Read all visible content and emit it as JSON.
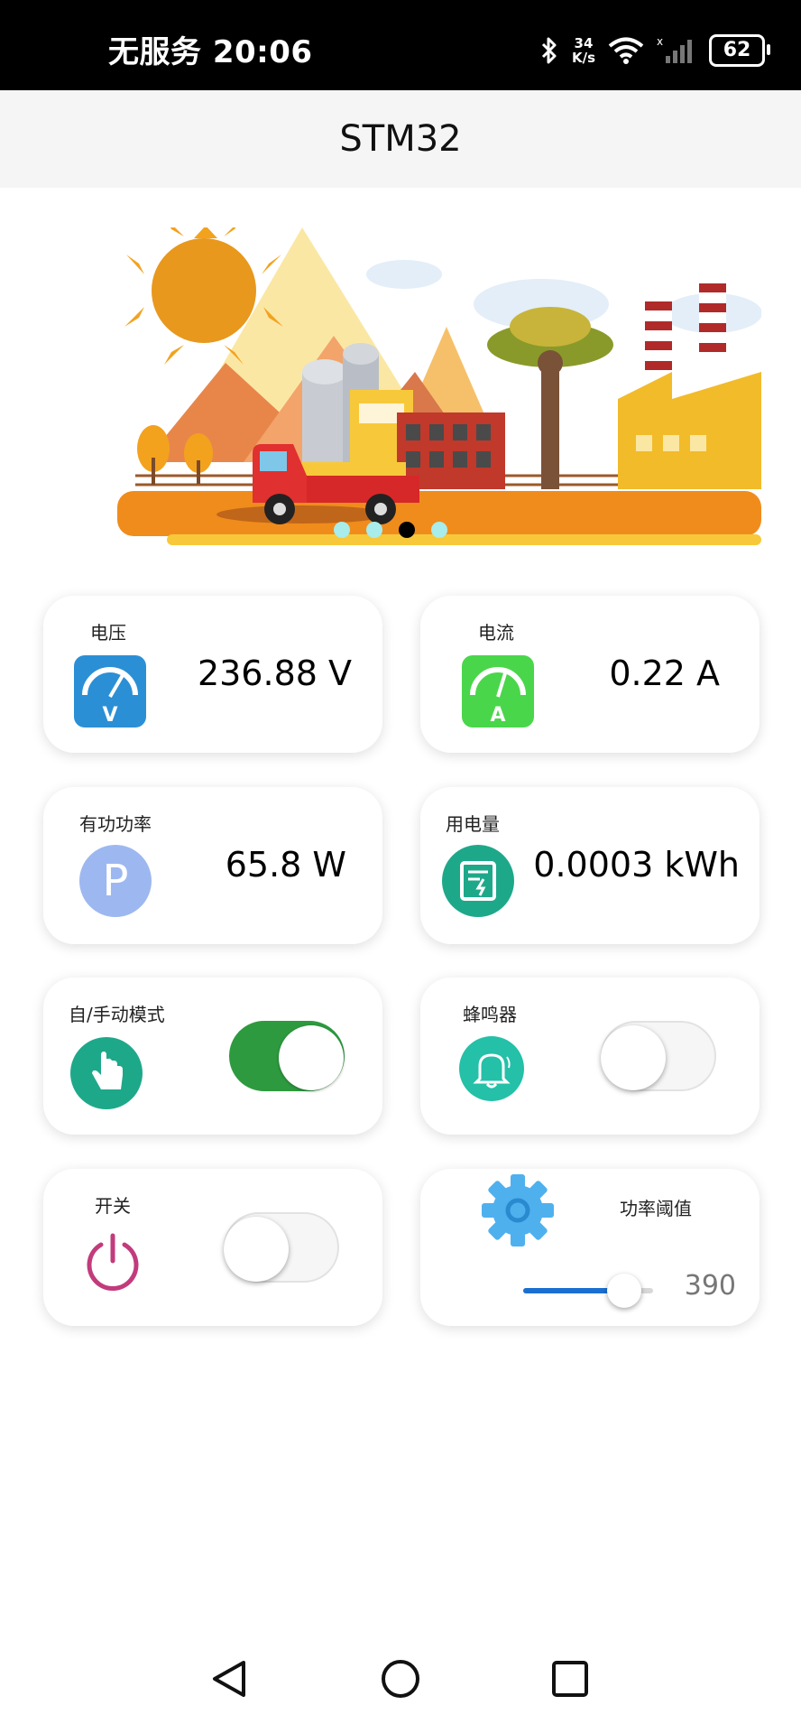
{
  "status_bar": {
    "carrier_time": "无服务 20:06",
    "speed_value": "34",
    "speed_unit": "K/s",
    "battery": "62",
    "icons": [
      "bluetooth-icon",
      "wifi-icon",
      "signal-icon",
      "battery-icon"
    ]
  },
  "app_bar": {
    "title": "STM32"
  },
  "banner": {
    "slide_count": 4,
    "active_slide": 3,
    "description_icons": [
      "sun",
      "mountains",
      "truck",
      "factory",
      "palm-tree"
    ]
  },
  "cards": {
    "voltage": {
      "label": "电压",
      "value": "236.88 V",
      "icon": "voltmeter-icon",
      "icon_color": "#2b8fd6"
    },
    "current": {
      "label": "电流",
      "value": "0.22 A",
      "icon": "ammeter-icon",
      "icon_color": "#4ad64a"
    },
    "power": {
      "label": "有功功率",
      "value": "65.8 W",
      "icon": "power-p-icon",
      "icon_color": "#9db8f0"
    },
    "energy": {
      "label": "用电量",
      "value": "0.0003 kWh",
      "icon": "energy-meter-icon",
      "icon_color": "#1ea88a"
    },
    "mode": {
      "label": "自/手动模式",
      "icon": "hand-icon",
      "icon_color": "#1ea88a",
      "switch_on": true
    },
    "buzzer": {
      "label": "蜂鸣器",
      "icon": "bell-icon",
      "icon_color": "#24c0a8",
      "switch_on": false
    },
    "power_switch": {
      "label": "开关",
      "icon": "power-icon",
      "icon_color": "#c23b7c",
      "switch_on": false
    },
    "threshold": {
      "label": "功率阈值",
      "value": "390",
      "icon": "gear-icon",
      "icon_color": "#4fb0ee",
      "slider_fraction": 0.78
    }
  },
  "colors": {
    "accent": "#2e9a3f",
    "slider": "#1b6fd0"
  },
  "nav_bar": {
    "icons": [
      "back-icon",
      "home-icon",
      "recents-icon"
    ]
  }
}
